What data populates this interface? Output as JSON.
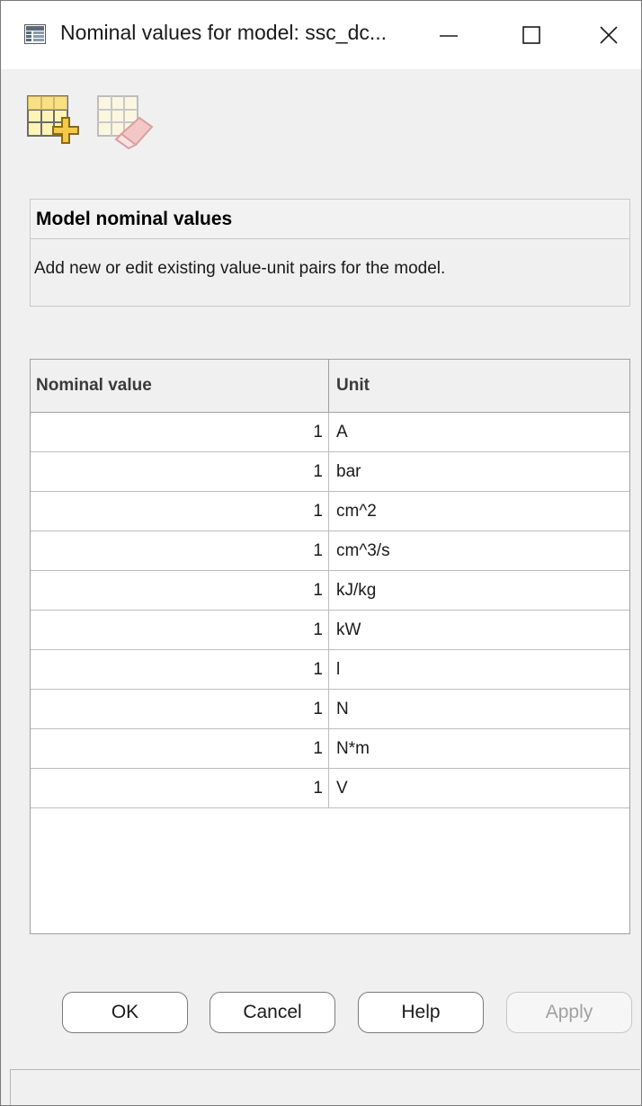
{
  "window": {
    "title": "Nominal values for model: ssc_dc...",
    "icon": "table-icon"
  },
  "toolbar": {
    "add_icon": "add-row-icon",
    "delete_icon": "delete-row-icon"
  },
  "info": {
    "heading": "Model nominal values",
    "description": "Add new or edit existing value-unit pairs for the model."
  },
  "table": {
    "headers": {
      "value": "Nominal value",
      "unit": "Unit"
    },
    "rows": [
      {
        "value": "1",
        "unit": "A"
      },
      {
        "value": "1",
        "unit": "bar"
      },
      {
        "value": "1",
        "unit": "cm^2"
      },
      {
        "value": "1",
        "unit": "cm^3/s"
      },
      {
        "value": "1",
        "unit": "kJ/kg"
      },
      {
        "value": "1",
        "unit": "kW"
      },
      {
        "value": "1",
        "unit": "l"
      },
      {
        "value": "1",
        "unit": "N"
      },
      {
        "value": "1",
        "unit": "N*m"
      },
      {
        "value": "1",
        "unit": "V"
      }
    ]
  },
  "buttons": {
    "ok": "OK",
    "cancel": "Cancel",
    "help": "Help",
    "apply": "Apply"
  }
}
